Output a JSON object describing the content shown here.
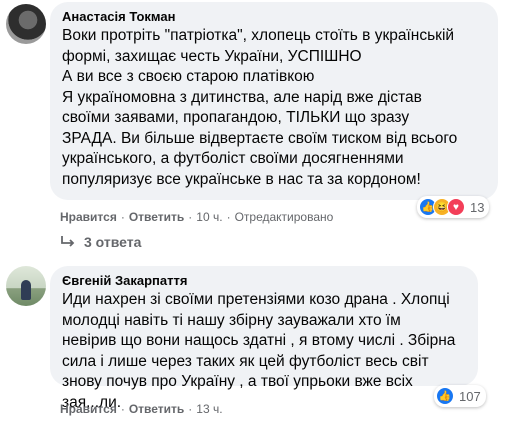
{
  "comments": [
    {
      "author": "Анастасія Токман",
      "text": "Воки протріть \"патріотка\", хлопець стоїть в українській\nформі, захищає честь України, УСПІШНО\nА ви все з своєю старою платівкою\nЯ україномовна з дитинства, але нарід вже дістав\nсвоїми заявами, пропагандою, ТІЛЬКИ що зразу\nЗРАДА. Ви більше відвертаєте своїм тиском від всього\nукраїнського, а футболіст своїми досягненнями\nпопуляризує все українське в нас та за кордоном!",
      "like_label": "Нравится",
      "reply_label": "Ответить",
      "time": "10 ч.",
      "edited": "Отредактировано",
      "reaction_count": "13",
      "reactions": [
        "like-icon",
        "haha-icon",
        "love-icon"
      ]
    },
    {
      "author": "Євгеній Закарпаття",
      "text": "Иди нахрен зі своїми претензіями козо драна . Хлопці\nмолодці навіть ті нашу збірну зауважали хто їм\nневірив що вони нащось здатні , я втому числі . Збірна\nсила і лише через таких як цей футболіст весь світ\nзнову почув про Україну , а твої упрьоки вже всіх\nзая...ли.",
      "like_label": "Нравится",
      "reply_label": "Ответить",
      "time": "13 ч.",
      "reaction_count": "107",
      "reactions": [
        "like-icon"
      ]
    }
  ],
  "replies_label": "3 ответа",
  "colors": {
    "bubble": "#f0f2f5",
    "meta": "#65676b",
    "like": "#1877f2",
    "love": "#f33e58",
    "haha": "#f7b125"
  }
}
